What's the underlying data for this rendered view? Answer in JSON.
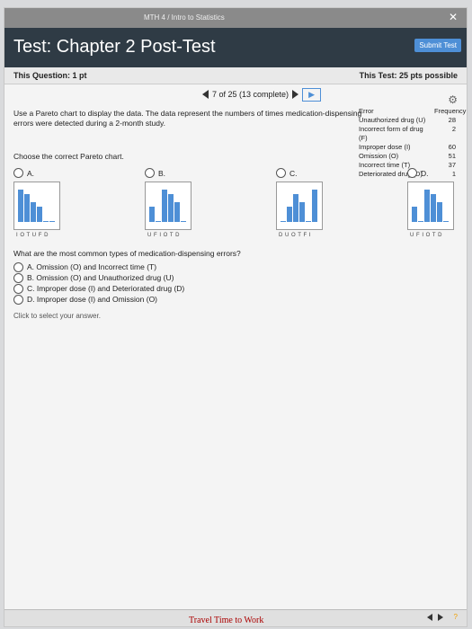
{
  "topbar": {
    "course": "MTH 4 / Intro to Statistics",
    "close_icon": "close-icon"
  },
  "header": {
    "title": "Test: Chapter 2 Post-Test",
    "submit_label": "Submit Test"
  },
  "question_info": {
    "left": "This Question: 1 pt",
    "right": "This Test: 25 pts possible"
  },
  "nav": {
    "counter": "7 of 25 (13 complete)"
  },
  "prompt": "Use a Pareto chart to display the data. The data represent the numbers of times medication-dispensing errors were detected during a 2-month study.",
  "table": {
    "headers": {
      "error": "Error",
      "freq": "Frequency"
    },
    "rows": [
      {
        "error": "Unauthorized drug (U)",
        "freq": "28"
      },
      {
        "error": "Incorrect form of drug (F)",
        "freq": "2"
      },
      {
        "error": "Improper dose (I)",
        "freq": "60"
      },
      {
        "error": "Omission (O)",
        "freq": "51"
      },
      {
        "error": "Incorrect time (T)",
        "freq": "37"
      },
      {
        "error": "Deteriorated drug (D)",
        "freq": "1"
      }
    ]
  },
  "choose_label": "Choose the correct Pareto chart.",
  "chart_options": [
    {
      "label": "A.",
      "ticks": "I O T U F D",
      "values": [
        60,
        51,
        37,
        28,
        2,
        1
      ]
    },
    {
      "label": "B.",
      "ticks": "U F I O T D",
      "values": [
        28,
        2,
        60,
        51,
        37,
        1
      ]
    },
    {
      "label": "C.",
      "ticks": "D U O T F I",
      "values": [
        1,
        28,
        51,
        37,
        2,
        60
      ]
    },
    {
      "label": "D.",
      "ticks": "U F I O T D",
      "values": [
        28,
        2,
        60,
        51,
        37,
        1
      ]
    }
  ],
  "question2": "What are the most common types of medication-dispensing errors?",
  "answers": [
    "A. Omission (O) and Incorrect time (T)",
    "B. Omission (O) and Unauthorized drug (U)",
    "C. Improper dose (I) and Deteriorated drug (D)",
    "D. Improper dose (I) and Omission (O)"
  ],
  "hint": "Click to select your answer.",
  "paper_text": "Travel Time to Work",
  "colors": {
    "accent": "#4e8fd6",
    "header_bg": "#2f3b45"
  }
}
